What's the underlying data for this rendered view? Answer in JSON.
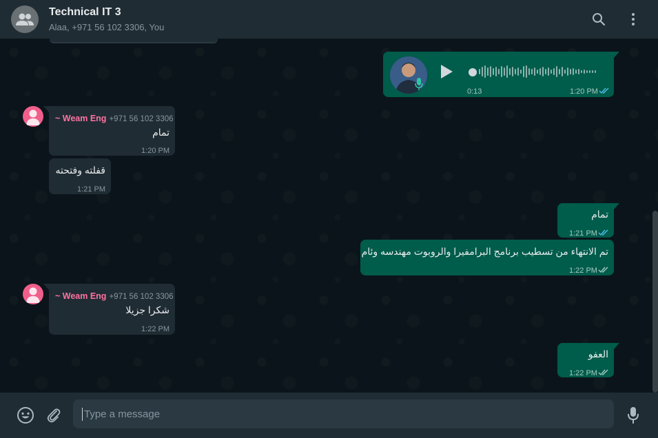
{
  "header": {
    "title": "Technical IT 3",
    "members": "Alaa, +971 56 102 3306, You",
    "icons": {
      "avatar": "group-icon",
      "search": "search-icon",
      "menu": "menu-dots-icon"
    }
  },
  "messages": {
    "voice": {
      "duration": "0:13",
      "time": "1:20 PM",
      "icon": "play-icon"
    },
    "m1": {
      "sender": "~ Weam Eng",
      "phone": "+971 56 102 3306",
      "text": "تمام",
      "time": "1:20 PM"
    },
    "m2": {
      "text": "قفلته وفتحته",
      "time": "1:21 PM"
    },
    "m3": {
      "text": "تمام",
      "time": "1:21 PM"
    },
    "m4": {
      "text": "تم الانتهاء من تسطيب برنامج البرامفيرا والروبوت مهندسه وئام",
      "time": "1:22 PM"
    },
    "m5": {
      "sender": "~ Weam Eng",
      "phone": "+971 56 102 3306",
      "text": "شكرا جزيلا",
      "time": "1:22 PM"
    },
    "m6": {
      "text": "العفو",
      "time": "1:22 PM"
    }
  },
  "composer": {
    "placeholder": "Type a message",
    "icons": {
      "emoji": "emoji-icon",
      "attach": "paperclip-icon",
      "mic": "microphone-icon"
    }
  },
  "colors": {
    "header_bg": "#202c33",
    "chat_bg": "#0b141a",
    "incoming_bubble": "#202c33",
    "outgoing_bubble": "#005c4b",
    "sender_name": "#ff72a1",
    "read_ticks": "#53bdeb"
  }
}
